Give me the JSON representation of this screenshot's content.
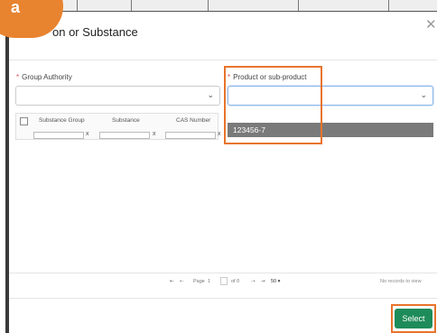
{
  "badge": {
    "letter": "a"
  },
  "modal": {
    "title": "on or Substance",
    "close_icon": "close-icon"
  },
  "fields": {
    "group_authority": {
      "label": "Group Authority",
      "required_mark": "*",
      "value": ""
    },
    "product": {
      "label": "Product or sub-product",
      "required_mark": "*",
      "value": ""
    }
  },
  "grid": {
    "columns": [
      "Substance Group",
      "Substance",
      "CAS Number"
    ],
    "filter_clear": "x"
  },
  "dropdown": {
    "options": [
      "123456-7"
    ]
  },
  "pager": {
    "first": "⇤",
    "prev": "⇠",
    "page_label": "Page",
    "page_value": "1",
    "of_label": "of 0",
    "next": "⇢",
    "last": "⇥",
    "page_size": "50",
    "no_records": "No records to view"
  },
  "footer": {
    "select_label": "Select"
  },
  "colors": {
    "accent": "#e8832f",
    "primary_button": "#1e8c5a",
    "required": "#d9534f"
  }
}
